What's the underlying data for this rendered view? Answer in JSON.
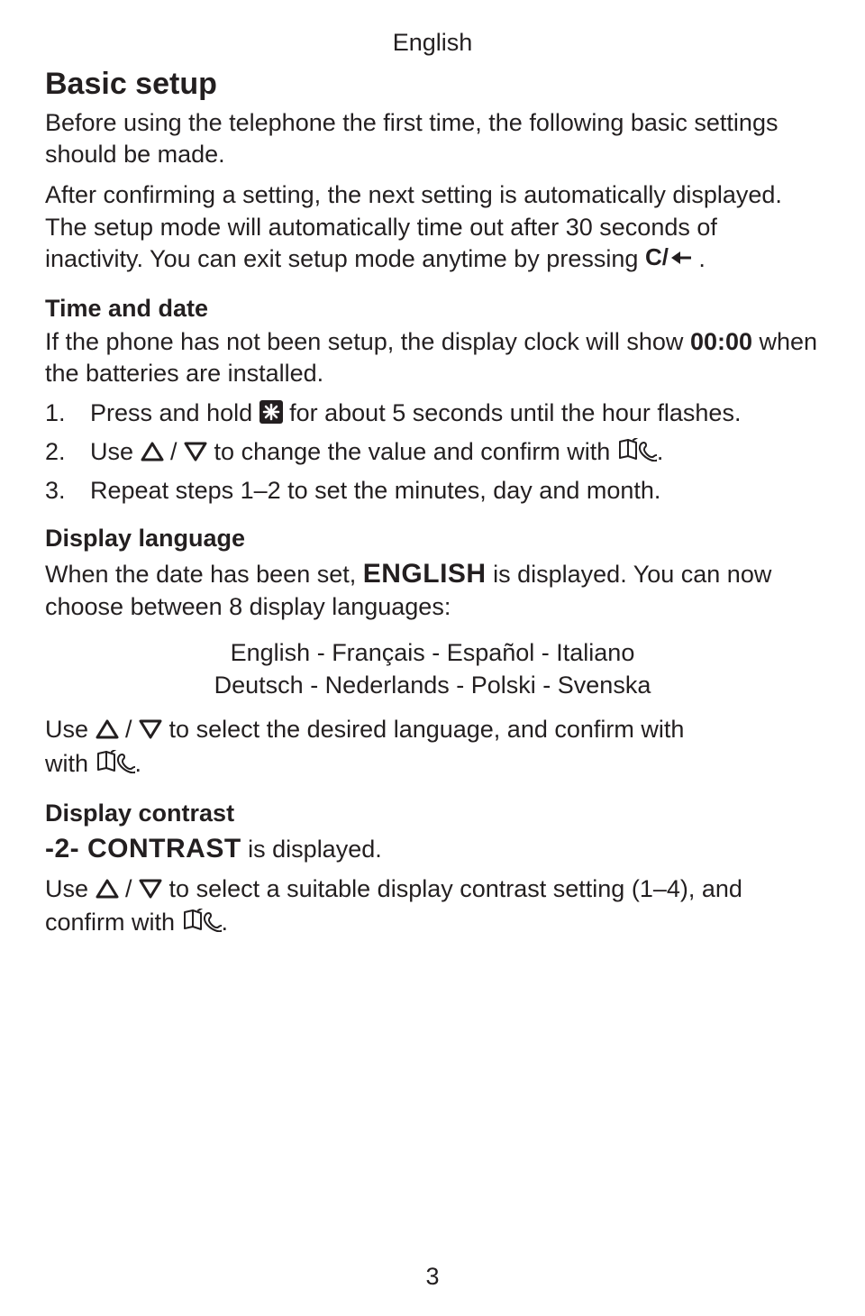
{
  "header": {
    "language": "English"
  },
  "title": "Basic setup",
  "intro1": "Before using the telephone the first time, the following basic settings should be made.",
  "intro2a": "After confirming a setting, the next setting is automatically displayed. The setup mode will automatically time out after 30 seconds of inactivity. You can exit setup mode anytime by pressing ",
  "intro2b": " .",
  "section_time": {
    "heading": "Time and date",
    "body_a": "If the phone has not been setup, the display clock will show ",
    "body_time": "00:00",
    "body_b": " when the batteries are installed.",
    "step1_num": "1.",
    "step1_a": "Press and hold ",
    "step1_b": " for about 5 seconds until the hour flashes.",
    "step2_num": "2.",
    "step2_a": "Use ",
    "step2_slash": " / ",
    "step2_b": " to change the value and confirm with ",
    "step2_c": ".",
    "step3_num": "3.",
    "step3": "Repeat steps 1–2 to set the minutes, day and month."
  },
  "section_lang": {
    "heading": "Display language",
    "body_a": "When the date has been set, ",
    "body_bold": "ENGLISH",
    "body_b": " is displayed. You can now choose between 8 display languages:",
    "langs1": "English - Français - Español - Italiano",
    "langs2": "Deutsch - Nederlands - Polski - Svenska",
    "instr_a": "Use ",
    "instr_slash": " / ",
    "instr_b": " to select the desired language, and confirm with ",
    "instr_c": "."
  },
  "section_contrast": {
    "heading": "Display contrast",
    "body_bold": "-2- CONTRAST",
    "body_a": " is displayed.",
    "instr_a": "Use ",
    "instr_slash": " / ",
    "instr_b": " to select a suitable display contrast setting (1–4), and confirm with ",
    "instr_c": "."
  },
  "page_number": "3"
}
